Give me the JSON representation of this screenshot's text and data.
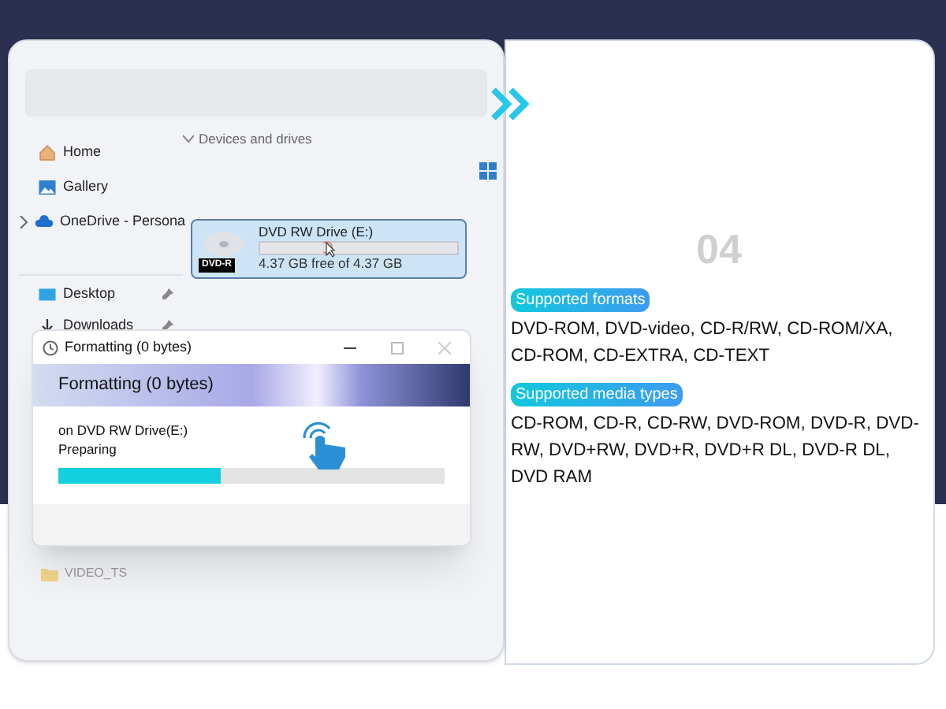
{
  "explorer": {
    "nav": [
      {
        "kind": "home",
        "label": "Home",
        "pinned": false
      },
      {
        "kind": "gallery",
        "label": "Gallery",
        "pinned": false
      },
      {
        "kind": "cloud",
        "label": "OneDrive - Persona",
        "pinned": false,
        "expanded": false
      },
      {
        "kind": "desktop",
        "label": "Desktop",
        "pinned": true
      },
      {
        "kind": "downloads",
        "label": "Downloads",
        "pinned": true
      }
    ],
    "section": {
      "label": "Devices and drives",
      "expanded": true
    },
    "drive": {
      "name": "DVD RW Drive (E:)",
      "disc_label": "DVD-R",
      "free": "4.37 GB free of 4.37 GB",
      "level": 0,
      "selected": true
    },
    "folder": "VIDEO_TS"
  },
  "dialog": {
    "title": "Formatting (0 bytes)",
    "header": "Formatting (0 bytes)",
    "target": "on DVD RW Drive(E:)",
    "status": "Preparing",
    "level": 0.42
  },
  "info": {
    "step": "04",
    "sections": [
      {
        "tag": "Supported formats",
        "body": "DVD-ROM, DVD-video, CD-R/RW, CD-ROM/XA, CD-ROM, CD-EXTRA, CD-TEXT"
      },
      {
        "tag": "Supported media types",
        "body": "CD-ROM, CD-R, CD-RW, DVD-ROM, DVD-R, DVD-RW, DVD+RW, DVD+R, DVD+R DL, DVD-R DL, DVD RAM"
      }
    ]
  }
}
